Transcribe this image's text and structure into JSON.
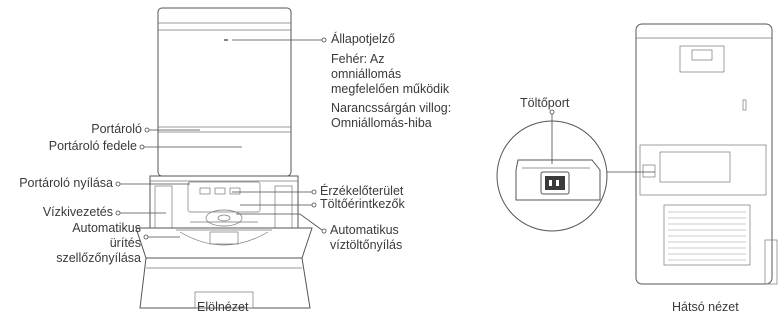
{
  "front": {
    "caption": "Elölnézet",
    "labels": {
      "status": "Állapotjelző",
      "status_white": "Fehér: Az\nomniállomás\nmegfelelően működik",
      "status_orange": "Narancssárgán villog:\nOmniállomás-hiba",
      "bin": "Portároló",
      "bin_lid": "Portároló fedele",
      "bin_opening": "Portároló nyílása",
      "water_line": "Vízkivezetés",
      "auto_empty_vent": "Automatikus\nürítés\nszellőzőnyílása",
      "sensor_area": "Érzékelőterület",
      "charging_contacts": "Töltőérintkezők",
      "auto_refill": "Automatikus\nvíztöltőnyílás"
    }
  },
  "rear": {
    "caption": "Hátsó nézet",
    "labels": {
      "charging_port": "Töltőport"
    }
  }
}
